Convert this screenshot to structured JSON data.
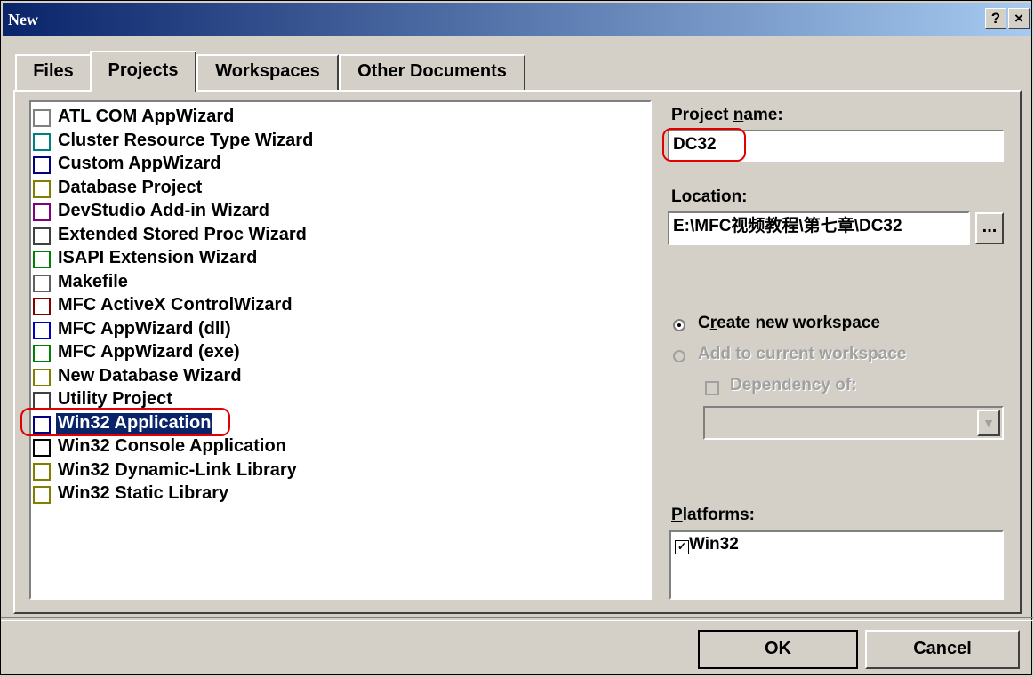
{
  "window": {
    "title": "New",
    "help_label": "?",
    "close_label": "×"
  },
  "tabs": [
    {
      "label": "Files",
      "active": false
    },
    {
      "label": "Projects",
      "active": true
    },
    {
      "label": "Workspaces",
      "active": false
    },
    {
      "label": "Other Documents",
      "active": false
    }
  ],
  "project_types": [
    {
      "label": "ATL COM AppWizard",
      "icon": "atl-com-icon",
      "color": "#808080"
    },
    {
      "label": "Cluster Resource Type Wizard",
      "icon": "cluster-wizard-icon",
      "color": "#008080"
    },
    {
      "label": "Custom AppWizard",
      "icon": "custom-wizard-icon",
      "color": "#000080"
    },
    {
      "label": "Database Project",
      "icon": "database-icon",
      "color": "#808000"
    },
    {
      "label": "DevStudio Add-in Wizard",
      "icon": "addin-icon",
      "color": "#800080"
    },
    {
      "label": "Extended Stored Proc Wizard",
      "icon": "stored-proc-icon",
      "color": "#404040"
    },
    {
      "label": "ISAPI Extension Wizard",
      "icon": "globe-icon",
      "color": "#008000"
    },
    {
      "label": "Makefile",
      "icon": "makefile-icon",
      "color": "#606060"
    },
    {
      "label": "MFC ActiveX ControlWizard",
      "icon": "activex-icon",
      "color": "#800000"
    },
    {
      "label": "MFC AppWizard (dll)",
      "icon": "mfc-dll-icon",
      "color": "#0000c0"
    },
    {
      "label": "MFC AppWizard (exe)",
      "icon": "mfc-exe-icon",
      "color": "#008000"
    },
    {
      "label": "New Database Wizard",
      "icon": "magic-wand-icon",
      "color": "#808000"
    },
    {
      "label": "Utility Project",
      "icon": "tools-icon",
      "color": "#404040"
    },
    {
      "label": "Win32 Application",
      "icon": "win32-app-icon",
      "color": "#000080",
      "selected": true
    },
    {
      "label": "Win32 Console Application",
      "icon": "console-icon",
      "color": "#000000"
    },
    {
      "label": "Win32 Dynamic-Link Library",
      "icon": "dll-icon",
      "color": "#808000"
    },
    {
      "label": "Win32 Static Library",
      "icon": "lib-icon",
      "color": "#808000"
    }
  ],
  "project_name": {
    "label": "Project name:",
    "value": "DC32"
  },
  "location": {
    "label": "Location:",
    "value": "E:\\MFC视频教程\\第七章\\DC32",
    "browse_label": "..."
  },
  "workspace": {
    "create_label": "Create new workspace",
    "add_label": "Add to current workspace",
    "dependency_label": "Dependency of:",
    "dependency_value": ""
  },
  "platforms": {
    "label": "Platforms:",
    "items": [
      {
        "label": "Win32",
        "checked": true
      }
    ]
  },
  "buttons": {
    "ok": "OK",
    "cancel": "Cancel"
  }
}
